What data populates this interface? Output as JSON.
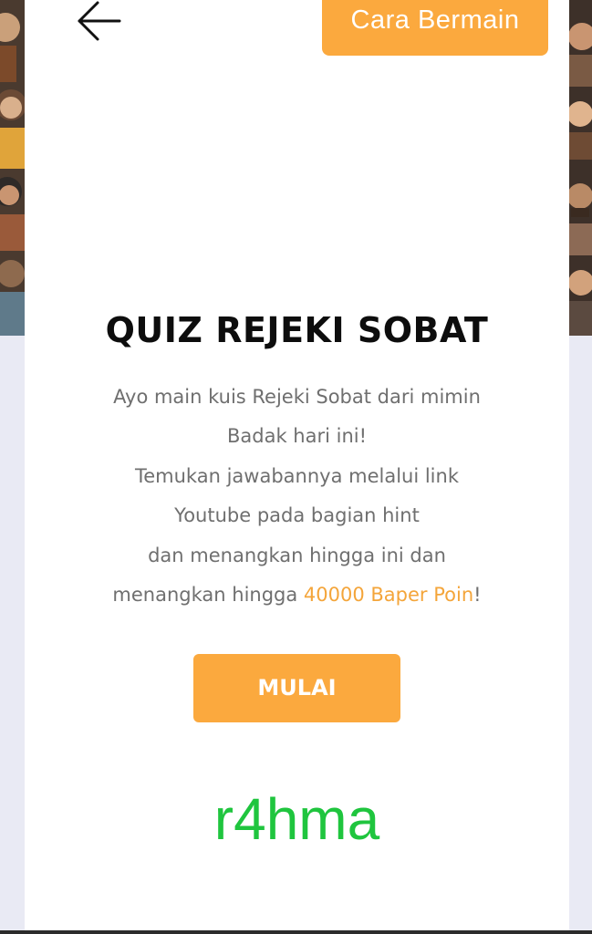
{
  "header": {
    "back_icon": "arrow-left-icon",
    "how_to_play_label": "Cara Bermain"
  },
  "quiz": {
    "title": "QUIZ REJEKI SOBAT",
    "description_lines": [
      "Ayo main kuis Rejeki Sobat dari mimin",
      "Badak hari ini!",
      "Temukan jawabannya melalui link",
      "Youtube pada bagian hint",
      "dan menangkan hingga ini dan"
    ],
    "description_last_prefix": "menangkan hingga ",
    "description_highlight": "40000 Baper Poin",
    "description_last_suffix": "!",
    "start_label": "MULAI"
  },
  "watermark": {
    "text": "r4hma"
  },
  "colors": {
    "accent": "#fba93e",
    "highlight_text": "#f4a53a",
    "watermark": "#1fc53e",
    "background": "#e9eaf4"
  }
}
